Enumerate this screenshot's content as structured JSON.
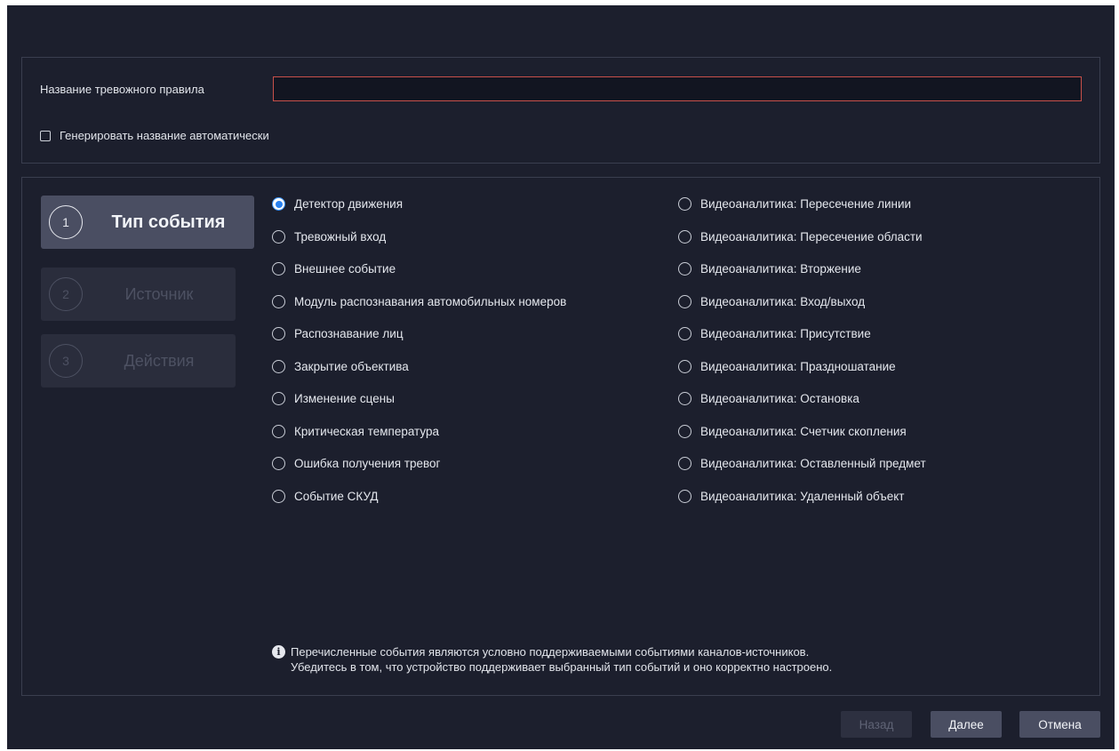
{
  "rule_name": {
    "label": "Название тревожного правила",
    "value": "",
    "auto_name_label": "Генерировать название автоматически",
    "auto_name_checked": false
  },
  "steps": [
    {
      "number": "1",
      "label": "Тип события",
      "state": "active"
    },
    {
      "number": "2",
      "label": "Источник",
      "state": "disabled"
    },
    {
      "number": "3",
      "label": "Действия",
      "state": "disabled"
    }
  ],
  "event_types": {
    "selected": "Детектор движения",
    "left": [
      "Детектор движения",
      "Тревожный вход",
      "Внешнее событие",
      "Модуль распознавания автомобильных номеров",
      "Распознавание лиц",
      "Закрытие объектива",
      "Изменение сцены",
      "Критическая температура",
      "Ошибка получения тревог",
      "Событие СКУД"
    ],
    "right": [
      "Видеоаналитика: Пересечение линии",
      "Видеоаналитика: Пересечение области",
      "Видеоаналитика: Вторжение",
      "Видеоаналитика: Вход/выход",
      "Видеоаналитика: Присутствие",
      "Видеоаналитика: Праздношатание",
      "Видеоаналитика: Остановка",
      "Видеоаналитика: Счетчик скопления",
      "Видеоаналитика: Оставленный предмет",
      "Видеоаналитика: Удаленный объект"
    ]
  },
  "info": {
    "icon": "info-icon",
    "line1": "Перечисленные события являются условно поддерживаемыми событиями каналов-источников.",
    "line2": "Убедитесь в том, что устройство поддерживает выбранный тип событий и оно корректно настроено."
  },
  "buttons": {
    "back": "Назад",
    "next": "Далее",
    "cancel": "Отмена"
  },
  "colors": {
    "background": "#1c1f2d",
    "accent": "#2a82f0",
    "error_border": "#c8504a"
  }
}
